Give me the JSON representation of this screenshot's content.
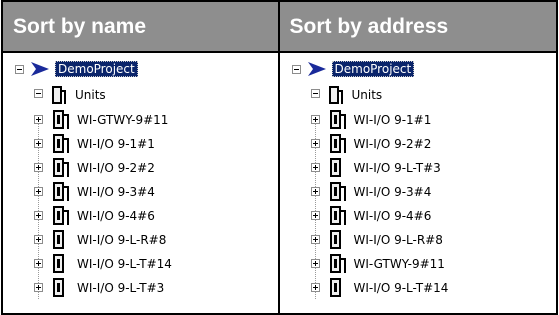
{
  "left": {
    "header": "Sort by name",
    "root": "DemoProject",
    "folder": "Units",
    "items": [
      {
        "label": "WI-GTWY-9#11",
        "icon": "device-wide-icon"
      },
      {
        "label": "WI-I/O 9-1#1",
        "icon": "device-wide-icon"
      },
      {
        "label": "WI-I/O 9-2#2",
        "icon": "device-wide-icon"
      },
      {
        "label": "WI-I/O 9-3#4",
        "icon": "device-wide-icon"
      },
      {
        "label": "WI-I/O 9-4#6",
        "icon": "device-wide-icon"
      },
      {
        "label": "WI-I/O 9-L-R#8",
        "icon": "device-narrow-icon"
      },
      {
        "label": "WI-I/O 9-L-T#14",
        "icon": "device-narrow-icon"
      },
      {
        "label": "WI-I/O 9-L-T#3",
        "icon": "device-narrow-icon"
      }
    ]
  },
  "right": {
    "header": "Sort by address",
    "root": "DemoProject",
    "folder": "Units",
    "items": [
      {
        "label": "WI-I/O 9-1#1",
        "icon": "device-wide-icon"
      },
      {
        "label": "WI-I/O 9-2#2",
        "icon": "device-wide-icon"
      },
      {
        "label": "WI-I/O 9-L-T#3",
        "icon": "device-narrow-icon"
      },
      {
        "label": "WI-I/O 9-3#4",
        "icon": "device-wide-icon"
      },
      {
        "label": "WI-I/O 9-4#6",
        "icon": "device-wide-icon"
      },
      {
        "label": "WI-I/O 9-L-R#8",
        "icon": "device-narrow-icon"
      },
      {
        "label": "WI-GTWY-9#11",
        "icon": "device-wide-icon"
      },
      {
        "label": "WI-I/O 9-L-T#14",
        "icon": "device-narrow-icon"
      }
    ]
  },
  "colors": {
    "header_bg": "#8e8e8e",
    "selection_bg": "#0a246a",
    "arrow": "#1a2a9a"
  }
}
